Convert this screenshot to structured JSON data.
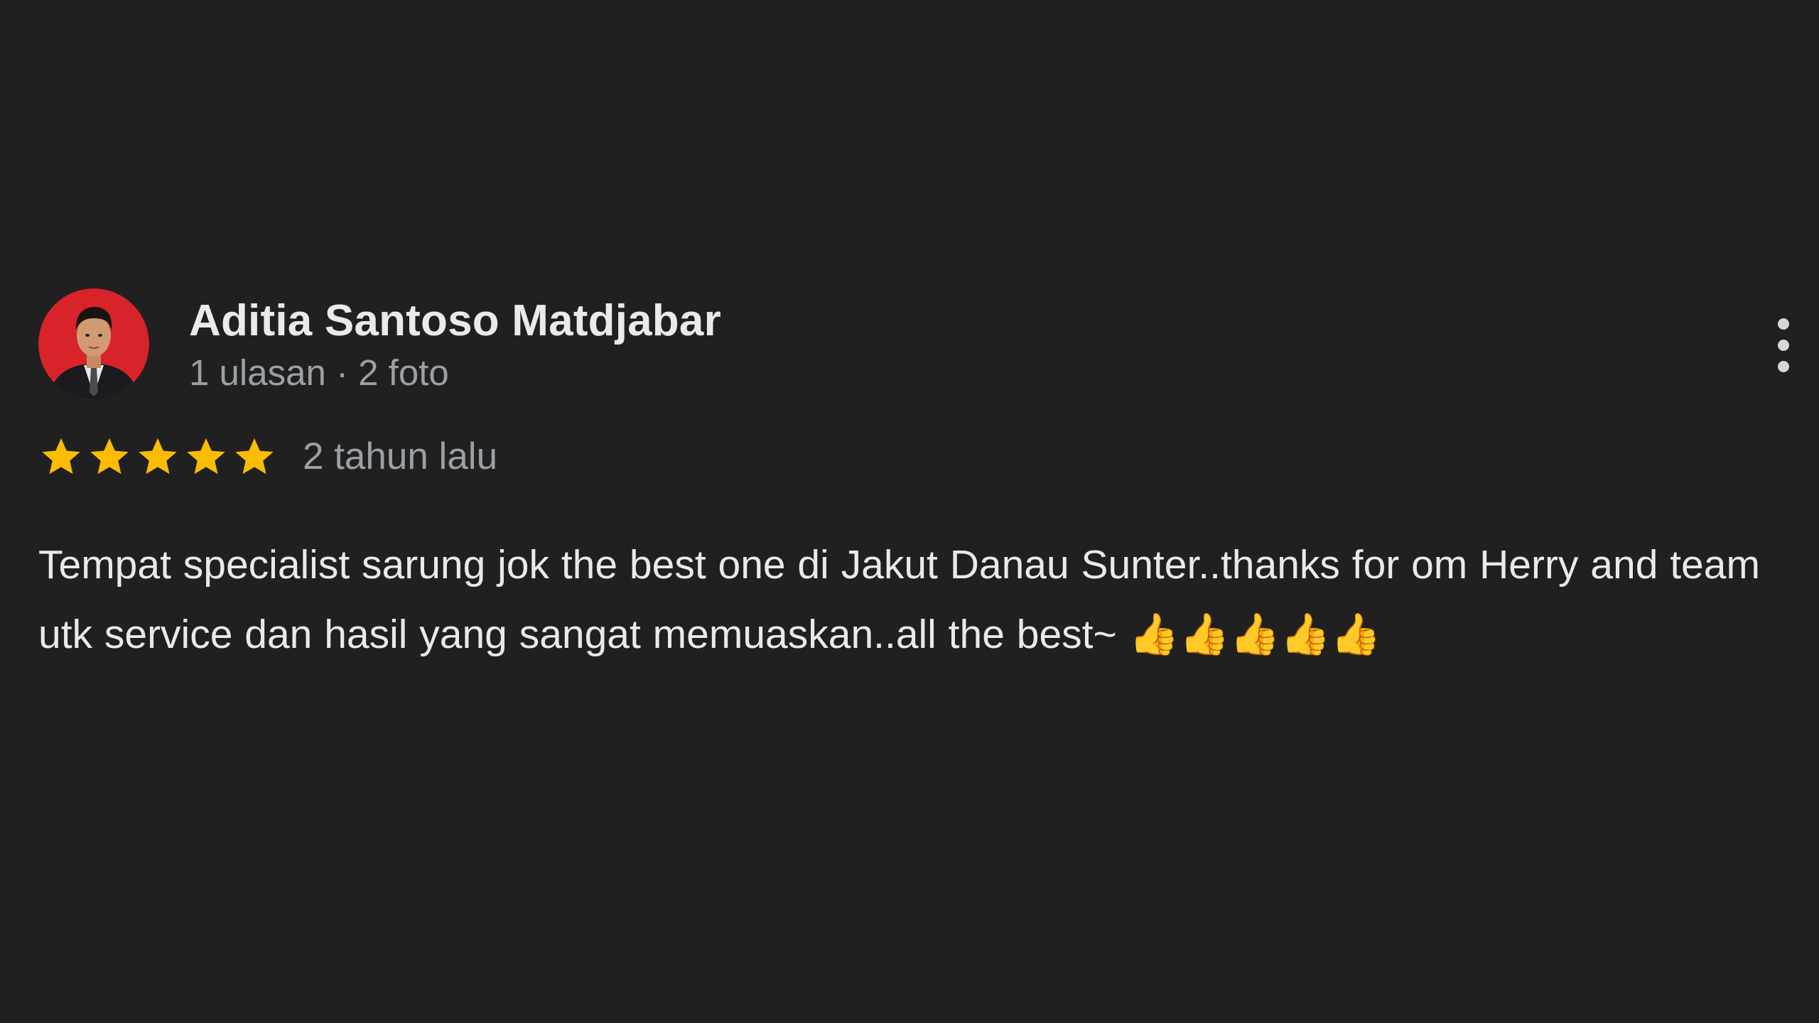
{
  "review": {
    "author": {
      "name": "Aditia Santoso Matdjabar",
      "meta": "1 ulasan · 2 foto",
      "avatar_icon": "profile-photo"
    },
    "rating": {
      "stars": 5,
      "max_stars": 5,
      "star_color": "#fbbc04"
    },
    "date": "2 tahun lalu",
    "text": "Tempat specialist sarung jok the best one di Jakut Danau Sunter..thanks for om Herry and team utk service dan hasil yang sangat memuaskan..all the best~ 👍👍👍👍👍",
    "menu_icon": "more-vert-icon"
  },
  "colors": {
    "background": "#202020",
    "primary_text": "#e8eaed",
    "secondary_text": "#9aa0a6"
  }
}
